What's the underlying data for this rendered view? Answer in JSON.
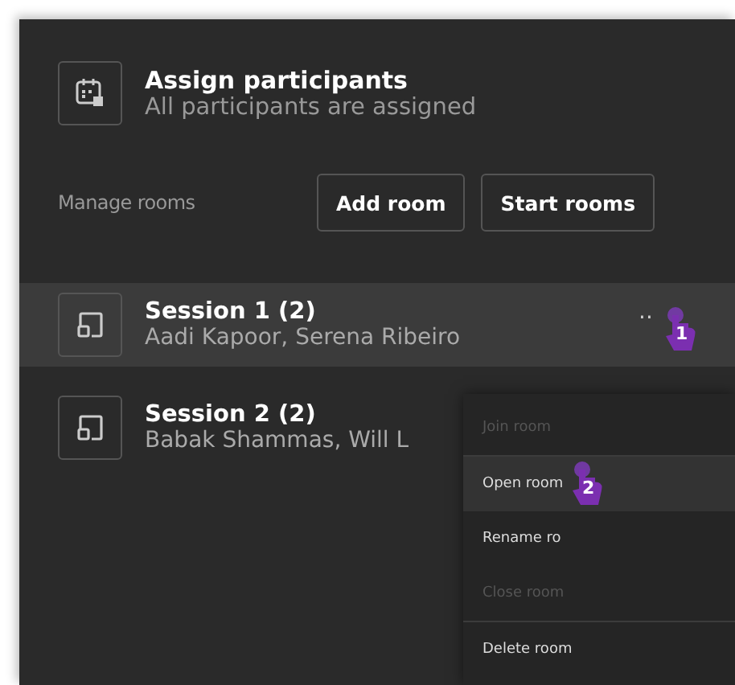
{
  "header": {
    "title": "Assign participants",
    "subtitle": "All participants are assigned"
  },
  "manage": {
    "label": "Manage rooms",
    "buttons": [
      "Add room",
      "Start rooms"
    ]
  },
  "rooms": [
    {
      "name": "Session 1 (2)",
      "participants": "Aadi Kapoor, Serena Ribeiro",
      "selected": true,
      "more": "··",
      "marker": "1"
    },
    {
      "name": "Session 2 (2)",
      "participants": "Babak Shammas, Will L",
      "selected": false
    }
  ],
  "menu": {
    "items": [
      {
        "label": "Join room",
        "disabled": true,
        "selected": false,
        "divider_after": true
      },
      {
        "label": "Open room",
        "disabled": false,
        "selected": true,
        "marker": "2"
      },
      {
        "label": "Rename ro",
        "disabled": false,
        "selected": false
      },
      {
        "label": "Close room",
        "disabled": true,
        "selected": false,
        "divider_after": true
      },
      {
        "label": "Delete room",
        "disabled": false,
        "selected": false
      }
    ]
  }
}
